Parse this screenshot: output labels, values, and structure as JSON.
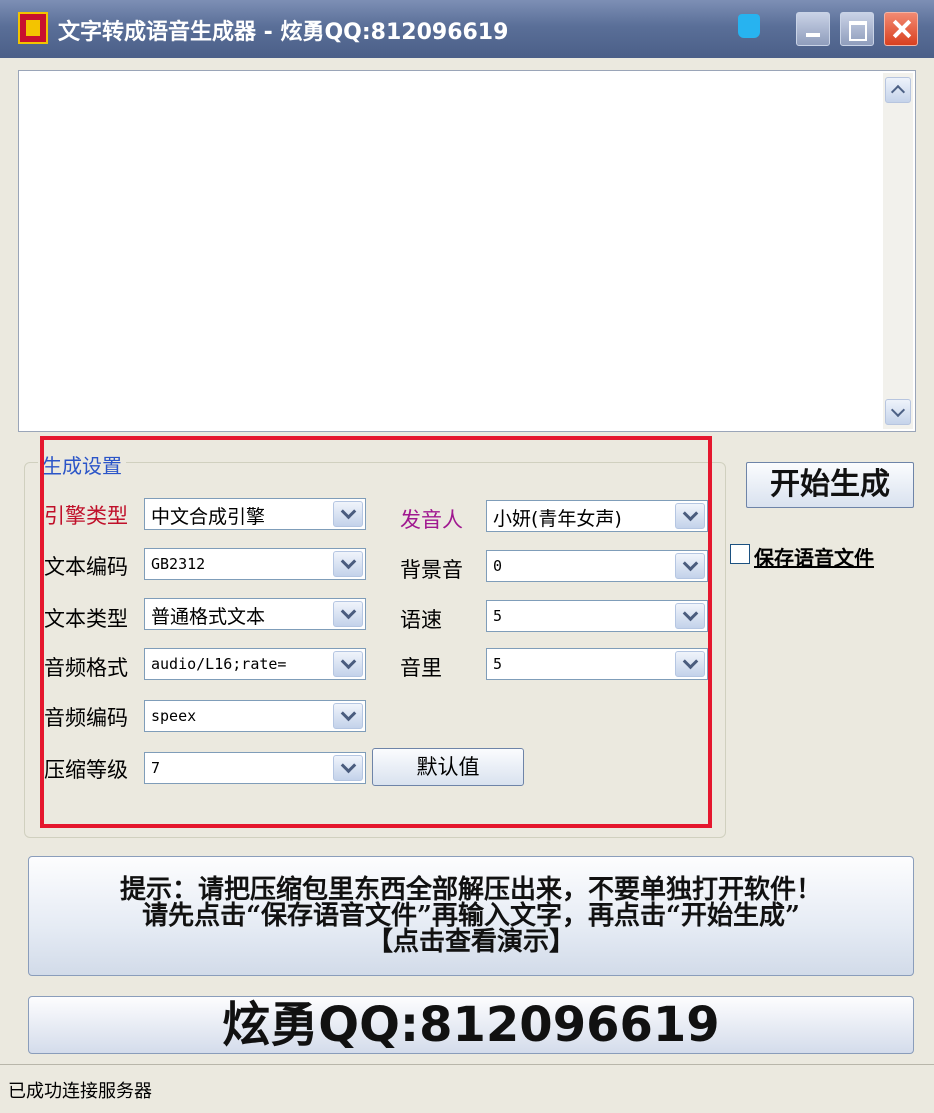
{
  "window": {
    "title": "文字转成语音生成器 - 炫勇QQ:812096619",
    "controls": [
      "minimize",
      "maximize",
      "close"
    ]
  },
  "textarea": {
    "value": ""
  },
  "settings": {
    "group_title": "生成设置",
    "engine": {
      "label": "引擎类型",
      "value": "中文合成引擎",
      "label_color": "#c0102a"
    },
    "encoding": {
      "label": "文本编码",
      "value": "GB2312"
    },
    "text_type": {
      "label": "文本类型",
      "value": "普通格式文本"
    },
    "audio_format": {
      "label": "音频格式",
      "value": "audio/L16;rate="
    },
    "audio_codec": {
      "label": "音频编码",
      "value": "speex"
    },
    "compression": {
      "label": "压缩等级",
      "value": "7"
    },
    "speaker": {
      "label": "发音人",
      "value": "小妍(青年女声)",
      "label_color": "#a01890"
    },
    "bg_sound": {
      "label": "背景音",
      "value": "0"
    },
    "speed": {
      "label": "语速",
      "value": "5"
    },
    "volume": {
      "label": "音里",
      "value": "5"
    },
    "default_button": "默认值"
  },
  "actions": {
    "start_button": "开始生成",
    "save_checkbox_label": "保存语音文件",
    "save_checked": false
  },
  "hint": {
    "line1": "提示：请把压缩包里东西全部解压出来，不要单独打开软件！",
    "line2": "请先点击“保存语音文件”再输入文字，再点击“开始生成”",
    "line3": "【点击查看演示】"
  },
  "qq_banner": "炫勇QQ:812096619",
  "status": "已成功连接服务器",
  "colors": {
    "accent_red": "#e5172e",
    "group_title": "#2b55c8"
  }
}
